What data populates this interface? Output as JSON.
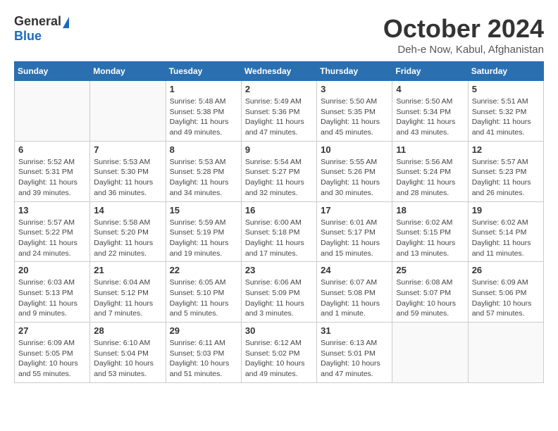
{
  "logo": {
    "general": "General",
    "blue": "Blue"
  },
  "title": {
    "month": "October 2024",
    "location": "Deh-e Now, Kabul, Afghanistan"
  },
  "weekdays": [
    "Sunday",
    "Monday",
    "Tuesday",
    "Wednesday",
    "Thursday",
    "Friday",
    "Saturday"
  ],
  "weeks": [
    [
      {
        "day": "",
        "info": ""
      },
      {
        "day": "",
        "info": ""
      },
      {
        "day": "1",
        "info": "Sunrise: 5:48 AM\nSunset: 5:38 PM\nDaylight: 11 hours and 49 minutes."
      },
      {
        "day": "2",
        "info": "Sunrise: 5:49 AM\nSunset: 5:36 PM\nDaylight: 11 hours and 47 minutes."
      },
      {
        "day": "3",
        "info": "Sunrise: 5:50 AM\nSunset: 5:35 PM\nDaylight: 11 hours and 45 minutes."
      },
      {
        "day": "4",
        "info": "Sunrise: 5:50 AM\nSunset: 5:34 PM\nDaylight: 11 hours and 43 minutes."
      },
      {
        "day": "5",
        "info": "Sunrise: 5:51 AM\nSunset: 5:32 PM\nDaylight: 11 hours and 41 minutes."
      }
    ],
    [
      {
        "day": "6",
        "info": "Sunrise: 5:52 AM\nSunset: 5:31 PM\nDaylight: 11 hours and 39 minutes."
      },
      {
        "day": "7",
        "info": "Sunrise: 5:53 AM\nSunset: 5:30 PM\nDaylight: 11 hours and 36 minutes."
      },
      {
        "day": "8",
        "info": "Sunrise: 5:53 AM\nSunset: 5:28 PM\nDaylight: 11 hours and 34 minutes."
      },
      {
        "day": "9",
        "info": "Sunrise: 5:54 AM\nSunset: 5:27 PM\nDaylight: 11 hours and 32 minutes."
      },
      {
        "day": "10",
        "info": "Sunrise: 5:55 AM\nSunset: 5:26 PM\nDaylight: 11 hours and 30 minutes."
      },
      {
        "day": "11",
        "info": "Sunrise: 5:56 AM\nSunset: 5:24 PM\nDaylight: 11 hours and 28 minutes."
      },
      {
        "day": "12",
        "info": "Sunrise: 5:57 AM\nSunset: 5:23 PM\nDaylight: 11 hours and 26 minutes."
      }
    ],
    [
      {
        "day": "13",
        "info": "Sunrise: 5:57 AM\nSunset: 5:22 PM\nDaylight: 11 hours and 24 minutes."
      },
      {
        "day": "14",
        "info": "Sunrise: 5:58 AM\nSunset: 5:20 PM\nDaylight: 11 hours and 22 minutes."
      },
      {
        "day": "15",
        "info": "Sunrise: 5:59 AM\nSunset: 5:19 PM\nDaylight: 11 hours and 19 minutes."
      },
      {
        "day": "16",
        "info": "Sunrise: 6:00 AM\nSunset: 5:18 PM\nDaylight: 11 hours and 17 minutes."
      },
      {
        "day": "17",
        "info": "Sunrise: 6:01 AM\nSunset: 5:17 PM\nDaylight: 11 hours and 15 minutes."
      },
      {
        "day": "18",
        "info": "Sunrise: 6:02 AM\nSunset: 5:15 PM\nDaylight: 11 hours and 13 minutes."
      },
      {
        "day": "19",
        "info": "Sunrise: 6:02 AM\nSunset: 5:14 PM\nDaylight: 11 hours and 11 minutes."
      }
    ],
    [
      {
        "day": "20",
        "info": "Sunrise: 6:03 AM\nSunset: 5:13 PM\nDaylight: 11 hours and 9 minutes."
      },
      {
        "day": "21",
        "info": "Sunrise: 6:04 AM\nSunset: 5:12 PM\nDaylight: 11 hours and 7 minutes."
      },
      {
        "day": "22",
        "info": "Sunrise: 6:05 AM\nSunset: 5:10 PM\nDaylight: 11 hours and 5 minutes."
      },
      {
        "day": "23",
        "info": "Sunrise: 6:06 AM\nSunset: 5:09 PM\nDaylight: 11 hours and 3 minutes."
      },
      {
        "day": "24",
        "info": "Sunrise: 6:07 AM\nSunset: 5:08 PM\nDaylight: 11 hours and 1 minute."
      },
      {
        "day": "25",
        "info": "Sunrise: 6:08 AM\nSunset: 5:07 PM\nDaylight: 10 hours and 59 minutes."
      },
      {
        "day": "26",
        "info": "Sunrise: 6:09 AM\nSunset: 5:06 PM\nDaylight: 10 hours and 57 minutes."
      }
    ],
    [
      {
        "day": "27",
        "info": "Sunrise: 6:09 AM\nSunset: 5:05 PM\nDaylight: 10 hours and 55 minutes."
      },
      {
        "day": "28",
        "info": "Sunrise: 6:10 AM\nSunset: 5:04 PM\nDaylight: 10 hours and 53 minutes."
      },
      {
        "day": "29",
        "info": "Sunrise: 6:11 AM\nSunset: 5:03 PM\nDaylight: 10 hours and 51 minutes."
      },
      {
        "day": "30",
        "info": "Sunrise: 6:12 AM\nSunset: 5:02 PM\nDaylight: 10 hours and 49 minutes."
      },
      {
        "day": "31",
        "info": "Sunrise: 6:13 AM\nSunset: 5:01 PM\nDaylight: 10 hours and 47 minutes."
      },
      {
        "day": "",
        "info": ""
      },
      {
        "day": "",
        "info": ""
      }
    ]
  ]
}
